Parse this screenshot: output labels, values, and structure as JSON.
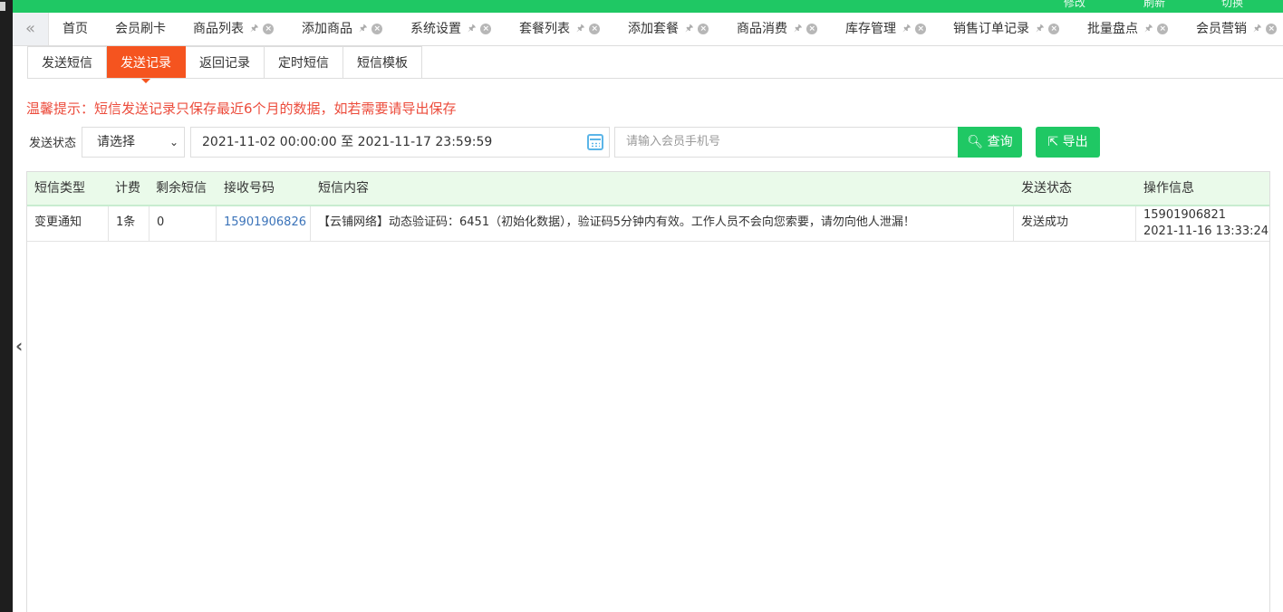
{
  "topbar": {
    "items": [
      "修改",
      "刷新",
      "切换"
    ]
  },
  "tabs": [
    {
      "label": "首页",
      "closable": false
    },
    {
      "label": "会员刷卡",
      "closable": false
    },
    {
      "label": "商品列表",
      "closable": true
    },
    {
      "label": "添加商品",
      "closable": true
    },
    {
      "label": "系统设置",
      "closable": true
    },
    {
      "label": "套餐列表",
      "closable": true
    },
    {
      "label": "添加套餐",
      "closable": true
    },
    {
      "label": "商品消费",
      "closable": true
    },
    {
      "label": "库存管理",
      "closable": true
    },
    {
      "label": "销售订单记录",
      "closable": true
    },
    {
      "label": "批量盘点",
      "closable": true
    },
    {
      "label": "会员营销",
      "closable": true
    }
  ],
  "subtabs": [
    "发送短信",
    "发送记录",
    "返回记录",
    "定时短信",
    "短信模板"
  ],
  "active_subtab": "发送记录",
  "notice": "温馨提示：短信发送记录只保存最近6个月的数据，如若需要请导出保存",
  "filter": {
    "status_label": "发送状态",
    "status_value": "请选择",
    "date_range": "2021-11-02 00:00:00 至 2021-11-17 23:59:59",
    "phone_placeholder": "请输入会员手机号",
    "query_label": "查询",
    "export_label": "导出"
  },
  "table": {
    "headers": [
      "短信类型",
      "计费",
      "剩余短信",
      "接收号码",
      "短信内容",
      "发送状态",
      "操作信息"
    ],
    "rows": [
      {
        "type": "变更通知",
        "fee": "1条",
        "remaining": "0",
        "phone": "15901906826",
        "content": "【云铺网络】动态验证码：6451（初始化数据），验证码5分钟内有效。工作人员不会向您索要，请勿向他人泄漏！",
        "status": "发送成功",
        "operator": "15901906821",
        "time": "2021-11-16 13:33:24"
      }
    ]
  },
  "colors": {
    "brand_green": "#1fc864",
    "active_tab": "#f5541f",
    "notice_red": "#ec4c3c",
    "link_blue": "#3b73b9"
  }
}
